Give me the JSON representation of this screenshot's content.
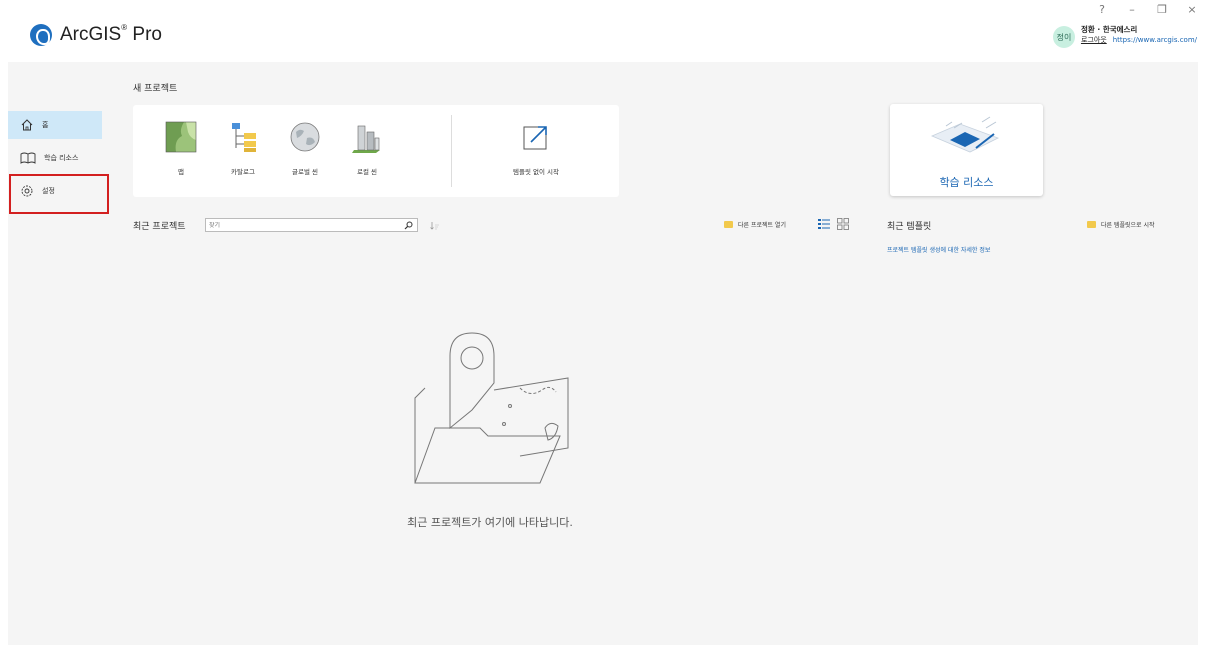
{
  "app": {
    "name": "ArcGIS",
    "suffix": "Pro",
    "trademark": "®"
  },
  "window_controls": [
    "?",
    "–",
    "❐",
    "×"
  ],
  "user": {
    "initials": "정이",
    "name": "정환 · 한국에스리",
    "signout": "로그아웃",
    "portal": "https://www.arcgis.com/"
  },
  "sidebar": {
    "items": [
      {
        "label": "홈",
        "icon": "home-icon",
        "active": true
      },
      {
        "label": "학습 리소스",
        "icon": "book-icon",
        "active": false
      },
      {
        "label": "설정",
        "icon": "gear-icon",
        "active": false
      }
    ]
  },
  "new_project": {
    "title": "새 프로젝트",
    "tiles": [
      {
        "label": "맵",
        "icon": "map-icon"
      },
      {
        "label": "카탈로그",
        "icon": "catalog-icon"
      },
      {
        "label": "글로벌 씬",
        "icon": "globe-icon"
      },
      {
        "label": "로컬 씬",
        "icon": "local-scene-icon"
      },
      {
        "label": "템플릿 없이 시작",
        "icon": "external-arrow-icon"
      }
    ]
  },
  "learning": {
    "label": "학습 리소스"
  },
  "recent_projects": {
    "title": "최근 프로젝트",
    "search_placeholder": "찾기",
    "open_other": "다른 프로젝트 열기",
    "empty_message": "최근 프로젝트가 여기에 나타납니다."
  },
  "recent_templates": {
    "title": "최근 템플릿",
    "info_link": "프로젝트 템플릿 생성에 대한 자세한 정보",
    "start_other": "다른 템플릿으로 시작"
  },
  "colors": {
    "accent": "#1a66b3",
    "highlight": "#d32020",
    "active_nav": "#cfe8f8"
  }
}
